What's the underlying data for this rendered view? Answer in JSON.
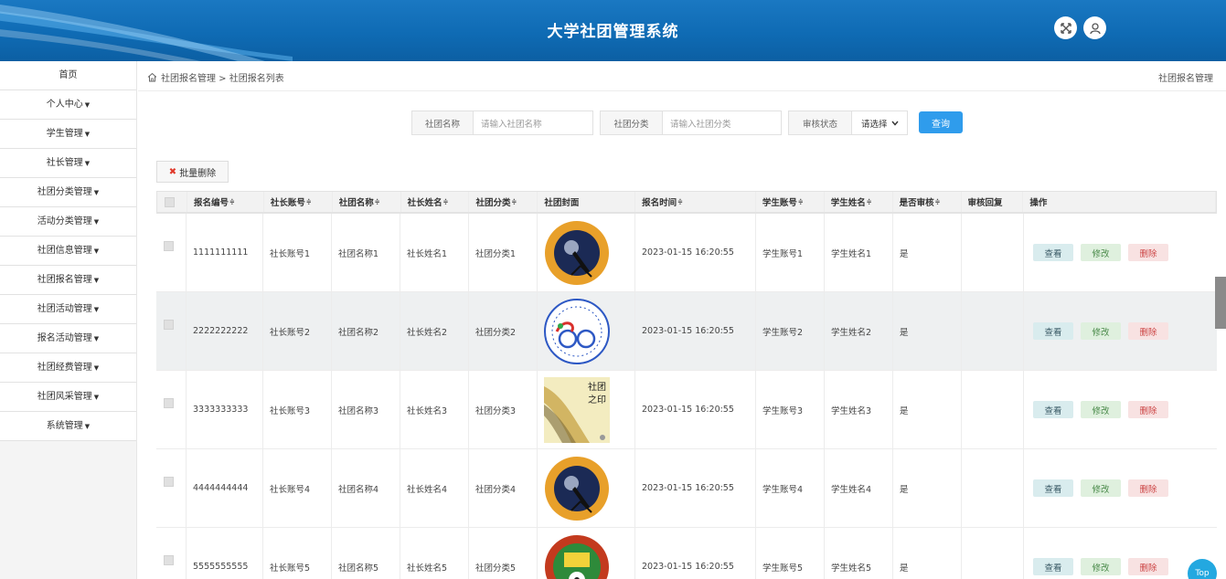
{
  "header": {
    "title": "大学社团管理系统"
  },
  "sidebar": {
    "items": [
      {
        "label": "首页",
        "caret": ""
      },
      {
        "label": "个人中心",
        "caret": "▼"
      },
      {
        "label": "学生管理",
        "caret": "▼"
      },
      {
        "label": "社长管理",
        "caret": "▼"
      },
      {
        "label": "社团分类管理",
        "caret": "▼"
      },
      {
        "label": "活动分类管理",
        "caret": "▼"
      },
      {
        "label": "社团信息管理",
        "caret": "▼"
      },
      {
        "label": "社团报名管理",
        "caret": "▼"
      },
      {
        "label": "社团活动管理",
        "caret": "▼"
      },
      {
        "label": "报名活动管理",
        "caret": "▼"
      },
      {
        "label": "社团经费管理",
        "caret": "▼"
      },
      {
        "label": "社团风采管理",
        "caret": "▼"
      },
      {
        "label": "系统管理",
        "caret": "▼"
      }
    ]
  },
  "breadcrumb": {
    "path": "社团报名管理 > 社团报名列表",
    "right": "社团报名管理"
  },
  "search": {
    "name_label": "社团名称",
    "name_placeholder": "请输入社团名称",
    "category_label": "社团分类",
    "category_placeholder": "请输入社团分类",
    "status_label": "审核状态",
    "status_value": "请选择",
    "query_button": "查询"
  },
  "bulk_delete": {
    "label": "批量删除",
    "icon": "✖"
  },
  "table": {
    "headers": [
      "报名编号",
      "社长账号",
      "社团名称",
      "社长姓名",
      "社团分类",
      "社团封面",
      "报名时间",
      "学生账号",
      "学生姓名",
      "是否审核",
      "审核回复",
      "操作"
    ],
    "sort_glyph": "≑",
    "rows": [
      {
        "id": "1111111111",
        "leader_acc": "社长账号1",
        "club": "社团名称1",
        "leader": "社长姓名1",
        "cat": "社团分类1",
        "cover": "astronomy",
        "time": "2023-01-15 16:20:55",
        "stu_acc": "学生账号1",
        "stu": "学生姓名1",
        "audit": "是",
        "reply": ""
      },
      {
        "id": "2222222222",
        "leader_acc": "社长账号2",
        "club": "社团名称2",
        "leader": "社长姓名2",
        "cat": "社团分类2",
        "cover": "cycling",
        "time": "2023-01-15 16:20:55",
        "stu_acc": "学生账号2",
        "stu": "学生姓名2",
        "audit": "是",
        "reply": ""
      },
      {
        "id": "3333333333",
        "leader_acc": "社长账号3",
        "club": "社团名称3",
        "leader": "社长姓名3",
        "cat": "社团分类3",
        "cover": "painting",
        "time": "2023-01-15 16:20:55",
        "stu_acc": "学生账号3",
        "stu": "学生姓名3",
        "audit": "是",
        "reply": ""
      },
      {
        "id": "4444444444",
        "leader_acc": "社长账号4",
        "club": "社团名称4",
        "leader": "社长姓名4",
        "cat": "社团分类4",
        "cover": "astronomy",
        "time": "2023-01-15 16:20:55",
        "stu_acc": "学生账号4",
        "stu": "学生姓名4",
        "audit": "是",
        "reply": ""
      },
      {
        "id": "5555555555",
        "leader_acc": "社长账号5",
        "club": "社团名称5",
        "leader": "社长姓名5",
        "cat": "社团分类5",
        "cover": "football",
        "time": "2023-01-15 16:20:55",
        "stu_acc": "学生账号5",
        "stu": "学生姓名5",
        "audit": "是",
        "reply": ""
      }
    ],
    "actions": {
      "view": "查看",
      "edit": "修改",
      "delete": "删除"
    }
  },
  "top_button": "Top",
  "colors": {
    "header": "#1170b8",
    "accent": "#2f9cec",
    "top": "#23a8e0"
  }
}
